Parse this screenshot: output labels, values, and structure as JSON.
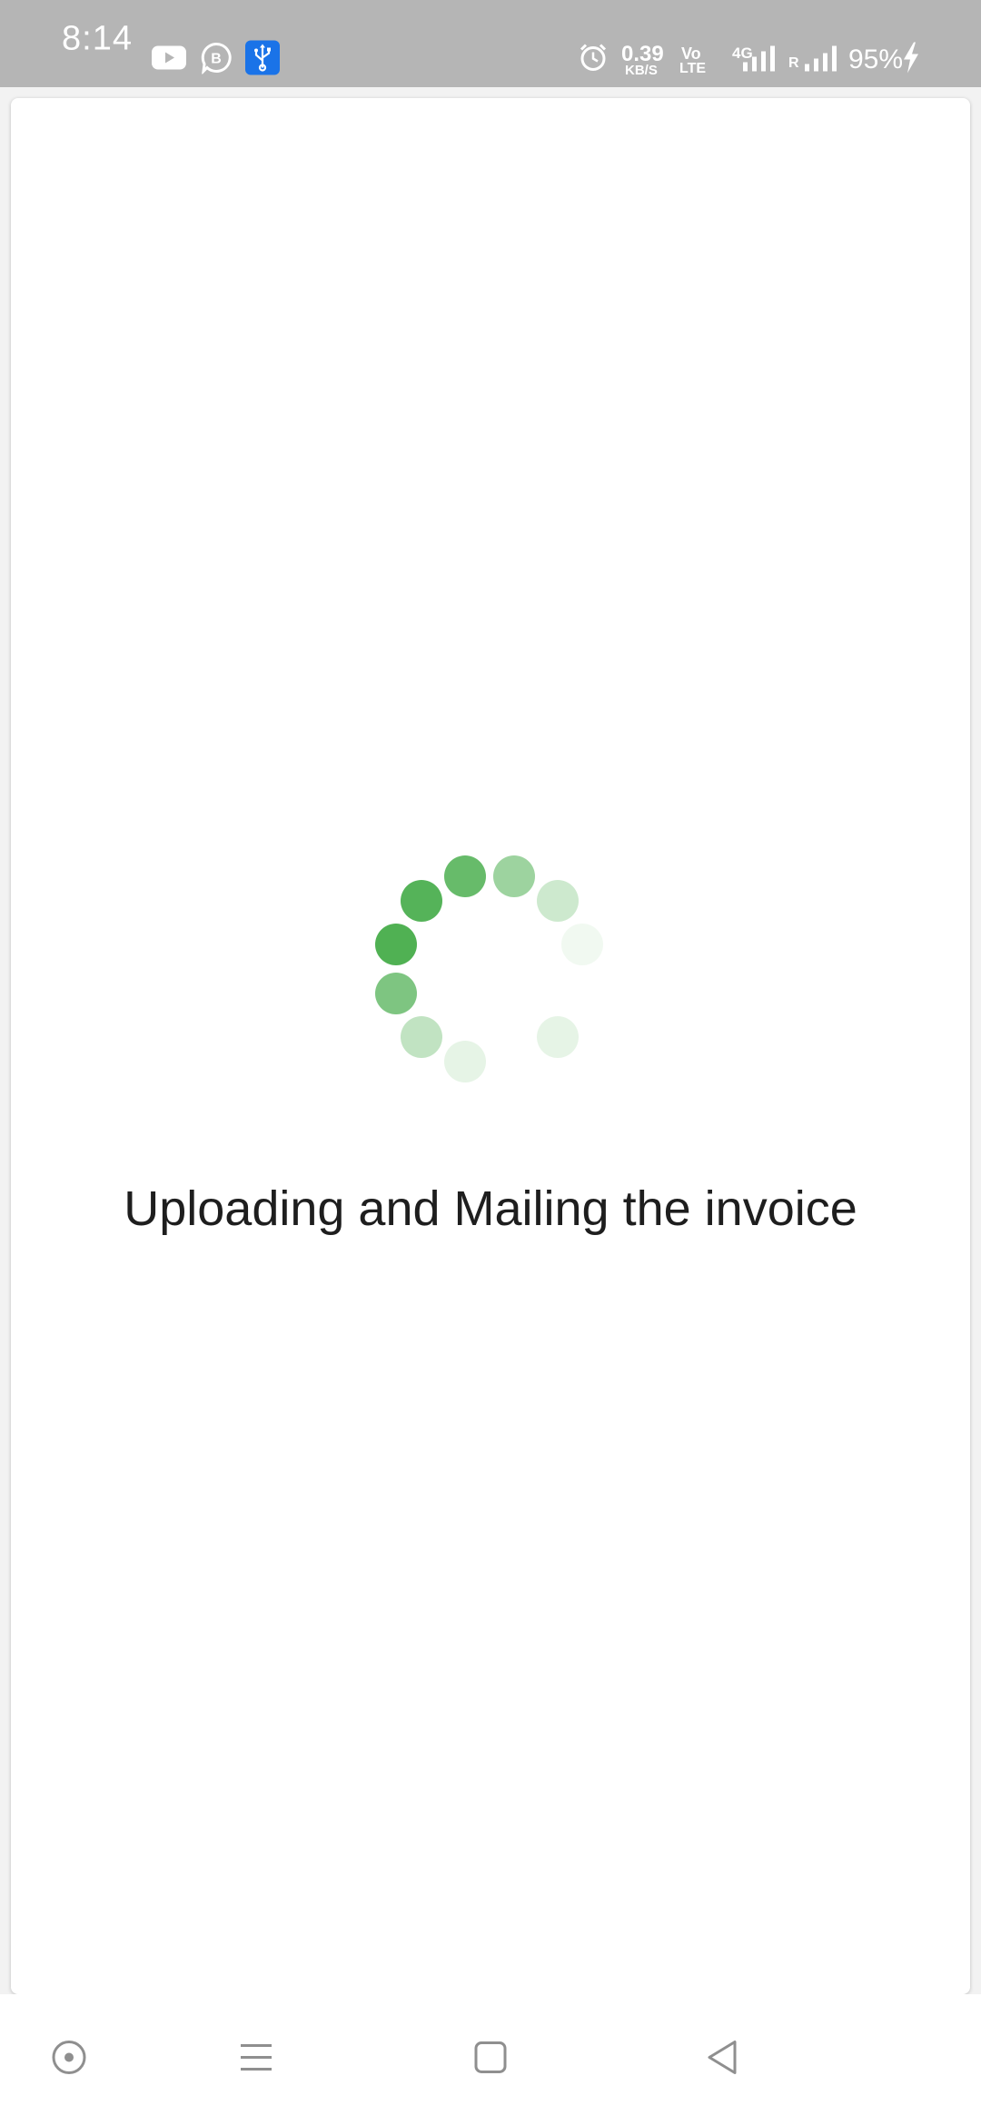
{
  "status_bar": {
    "time": "8:14",
    "net_speed_value": "0.39",
    "net_speed_unit": "KB/S",
    "volte_top": "Vo",
    "volte_bottom": "LTE",
    "network_type": "4G",
    "roaming_label": "R",
    "battery": "95%",
    "icons": [
      "youtube-icon",
      "b-notification-icon",
      "usb-icon",
      "alarm-icon",
      "signal-icon",
      "battery-charging-icon"
    ]
  },
  "main": {
    "loading_message": "Uploading and Mailing the invoice",
    "spinner_color": "#4caf50"
  },
  "nav_bar": {
    "buttons": [
      "assistant-button",
      "recents-button",
      "home-button",
      "back-button"
    ]
  }
}
